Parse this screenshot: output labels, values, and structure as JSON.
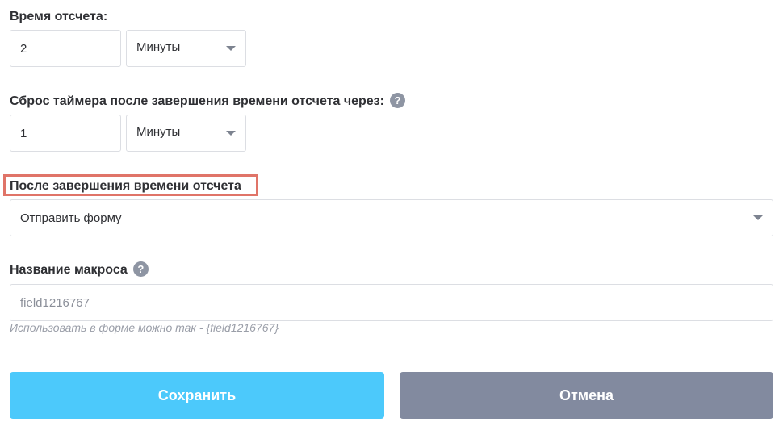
{
  "countdown": {
    "label": "Время отсчета:",
    "value": "2",
    "unit": "Минуты"
  },
  "reset": {
    "label": "Сброс таймера после завершения времени отсчета через:",
    "help_icon": "question-circle-icon",
    "value": "1",
    "unit": "Минуты"
  },
  "after_finish": {
    "label": "После завершения времени отсчета",
    "action": "Отправить форму",
    "highlight_color": "#e07468"
  },
  "macro": {
    "label": "Название макроса",
    "help_icon": "question-circle-icon",
    "placeholder": "field1216767",
    "hint": "Использовать в форме можно так - {field1216767}"
  },
  "buttons": {
    "save_label": "Сохранить",
    "save_color": "#4cc9fb",
    "cancel_label": "Отмена",
    "cancel_color": "#828a9f"
  }
}
